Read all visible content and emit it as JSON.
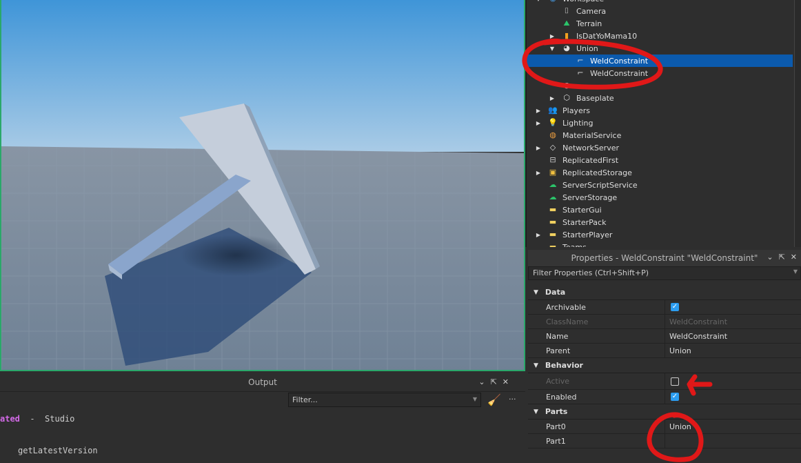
{
  "explorer": {
    "items": [
      {
        "label": "Workspace",
        "icon": "workspace-icon",
        "expanded": true,
        "depth": 0
      },
      {
        "label": "Camera",
        "icon": "camera-icon",
        "depth": 1
      },
      {
        "label": "Terrain",
        "icon": "terrain-icon",
        "depth": 1
      },
      {
        "label": "IsDatYoMama10",
        "icon": "model-icon",
        "expandable": true,
        "depth": 1
      },
      {
        "label": "Union",
        "icon": "union-icon",
        "expanded": true,
        "depth": 1
      },
      {
        "label": "WeldConstraint",
        "icon": "weld-constraint-icon",
        "depth": 2,
        "selected": true
      },
      {
        "label": "WeldConstraint",
        "icon": "weld-constraint-icon",
        "depth": 2
      },
      {
        "label": "",
        "icon": "union-icon",
        "depth": 1
      },
      {
        "label": "Baseplate",
        "icon": "part-icon",
        "expandable": true,
        "depth": 1
      },
      {
        "label": "Players",
        "icon": "players-icon",
        "expandable": true,
        "depth": 0
      },
      {
        "label": "Lighting",
        "icon": "lighting-icon",
        "expandable": true,
        "depth": 0
      },
      {
        "label": "MaterialService",
        "icon": "material-service-icon",
        "depth": 0
      },
      {
        "label": "NetworkServer",
        "icon": "network-server-icon",
        "expandable": true,
        "depth": 0
      },
      {
        "label": "ReplicatedFirst",
        "icon": "replicated-first-icon",
        "depth": 0
      },
      {
        "label": "ReplicatedStorage",
        "icon": "replicated-storage-icon",
        "expandable": true,
        "depth": 0
      },
      {
        "label": "ServerScriptService",
        "icon": "server-script-service-icon",
        "depth": 0
      },
      {
        "label": "ServerStorage",
        "icon": "server-storage-icon",
        "depth": 0
      },
      {
        "label": "StarterGui",
        "icon": "starter-gui-icon",
        "depth": 0
      },
      {
        "label": "StarterPack",
        "icon": "starter-pack-icon",
        "depth": 0
      },
      {
        "label": "StarterPlayer",
        "icon": "starter-player-icon",
        "expandable": true,
        "depth": 0
      },
      {
        "label": "Teams",
        "icon": "teams-icon",
        "depth": 0
      }
    ]
  },
  "properties": {
    "title": "Properties - WeldConstraint \"WeldConstraint\"",
    "filter_placeholder": "Filter Properties (Ctrl+Shift+P)",
    "sections": [
      {
        "name": "Data",
        "rows": [
          {
            "name": "Archivable",
            "type": "checkbox",
            "checked": true
          },
          {
            "name": "ClassName",
            "value": "WeldConstraint",
            "disabled": true
          },
          {
            "name": "Name",
            "value": "WeldConstraint"
          },
          {
            "name": "Parent",
            "value": "Union"
          }
        ]
      },
      {
        "name": "Behavior",
        "rows": [
          {
            "name": "Active",
            "type": "checkbox",
            "checked": false,
            "disabled": true
          },
          {
            "name": "Enabled",
            "type": "checkbox",
            "checked": true
          }
        ]
      },
      {
        "name": "Parts",
        "rows": [
          {
            "name": "Part0",
            "value": "Union"
          },
          {
            "name": "Part1",
            "value": ""
          }
        ]
      }
    ]
  },
  "output": {
    "title": "Output",
    "filter_placeholder": "Filter...",
    "lines": [
      {
        "parts": [
          {
            "text": "ated",
            "color": "#d36ae8"
          },
          {
            "text": "  -  Studio",
            "color": "#cccccc"
          }
        ]
      },
      {
        "parts": [
          {
            "text": "",
            "color": "#ccc"
          }
        ]
      },
      {
        "parts": [
          {
            "text": "getLatestVersion",
            "color": "#cccccc"
          }
        ]
      }
    ]
  },
  "colors": {
    "selection": "#0b5aad",
    "viewport_border": "#2aa86a",
    "annotation": "#e01818",
    "checkbox": "#2c9df0"
  }
}
